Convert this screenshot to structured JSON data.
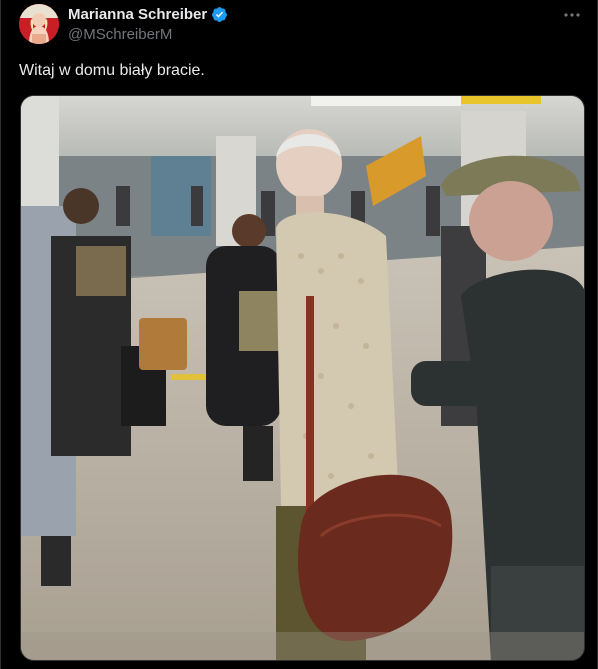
{
  "author": {
    "display_name": "Marianna Schreiber",
    "handle": "@MSchreiberM",
    "verified_icon": "verified-badge-icon",
    "avatar_icon": "avatar"
  },
  "tweet": {
    "text": "Witaj w domu biały bracie.",
    "more_icon": "more-options-icon"
  },
  "media": {
    "type": "photo",
    "description_icon": "airport-terminal-photo"
  },
  "colors": {
    "background": "#000000",
    "text_primary": "#e7e9ea",
    "text_secondary": "#71767b",
    "verified": "#1d9bf0",
    "border": "#2f3336"
  }
}
